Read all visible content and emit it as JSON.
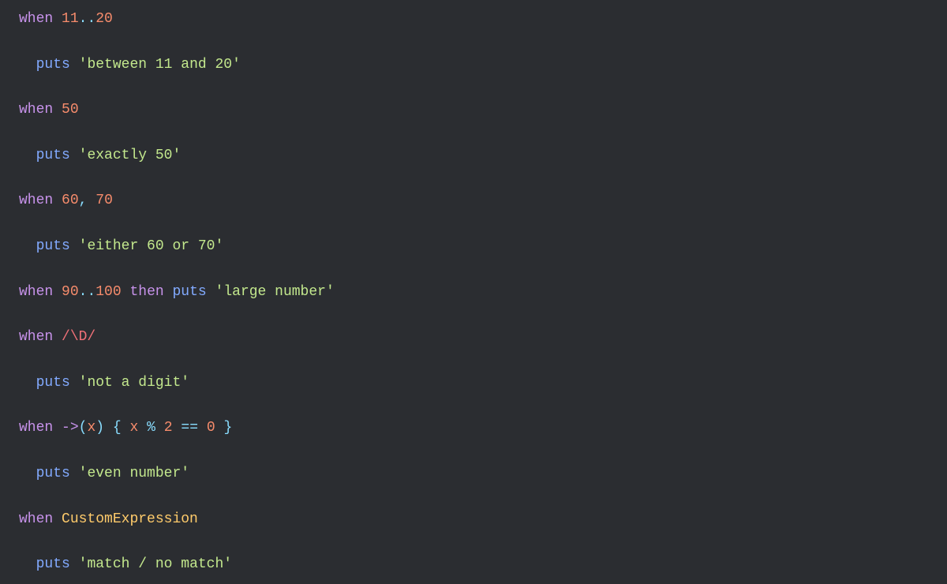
{
  "code": {
    "lines": [
      {
        "id": "line-when-11-20",
        "tokens": [
          {
            "type": "kw-when",
            "text": "when"
          },
          {
            "type": "plain",
            "text": " "
          },
          {
            "type": "num",
            "text": "11"
          },
          {
            "type": "op",
            "text": ".."
          },
          {
            "type": "num",
            "text": "20"
          }
        ]
      },
      {
        "id": "line-blank-1",
        "tokens": []
      },
      {
        "id": "line-puts-between",
        "tokens": [
          {
            "type": "plain",
            "text": "  "
          },
          {
            "type": "kw-puts",
            "text": "puts"
          },
          {
            "type": "plain",
            "text": " "
          },
          {
            "type": "str",
            "text": "'between 11 and 20'"
          }
        ]
      },
      {
        "id": "line-blank-2",
        "tokens": []
      },
      {
        "id": "line-when-50",
        "tokens": [
          {
            "type": "kw-when",
            "text": "when"
          },
          {
            "type": "plain",
            "text": " "
          },
          {
            "type": "num",
            "text": "50"
          }
        ]
      },
      {
        "id": "line-blank-3",
        "tokens": []
      },
      {
        "id": "line-puts-exactly",
        "tokens": [
          {
            "type": "plain",
            "text": "  "
          },
          {
            "type": "kw-puts",
            "text": "puts"
          },
          {
            "type": "plain",
            "text": " "
          },
          {
            "type": "str",
            "text": "'exactly 50'"
          }
        ]
      },
      {
        "id": "line-blank-4",
        "tokens": []
      },
      {
        "id": "line-when-60-70",
        "tokens": [
          {
            "type": "kw-when",
            "text": "when"
          },
          {
            "type": "plain",
            "text": " "
          },
          {
            "type": "num",
            "text": "60"
          },
          {
            "type": "punct",
            "text": ","
          },
          {
            "type": "plain",
            "text": " "
          },
          {
            "type": "num",
            "text": "70"
          }
        ]
      },
      {
        "id": "line-blank-5",
        "tokens": []
      },
      {
        "id": "line-puts-either",
        "tokens": [
          {
            "type": "plain",
            "text": "  "
          },
          {
            "type": "kw-puts",
            "text": "puts"
          },
          {
            "type": "plain",
            "text": " "
          },
          {
            "type": "str",
            "text": "'either 60 or 70'"
          }
        ]
      },
      {
        "id": "line-blank-6",
        "tokens": []
      },
      {
        "id": "line-when-90-100",
        "tokens": [
          {
            "type": "kw-when",
            "text": "when"
          },
          {
            "type": "plain",
            "text": " "
          },
          {
            "type": "num",
            "text": "90"
          },
          {
            "type": "op",
            "text": ".."
          },
          {
            "type": "num",
            "text": "100"
          },
          {
            "type": "plain",
            "text": " "
          },
          {
            "type": "kw-then",
            "text": "then"
          },
          {
            "type": "plain",
            "text": " "
          },
          {
            "type": "kw-puts",
            "text": "puts"
          },
          {
            "type": "plain",
            "text": " "
          },
          {
            "type": "str",
            "text": "'large number'"
          }
        ]
      },
      {
        "id": "line-blank-7",
        "tokens": []
      },
      {
        "id": "line-when-regex",
        "tokens": [
          {
            "type": "kw-when",
            "text": "when"
          },
          {
            "type": "plain",
            "text": " "
          },
          {
            "type": "regex",
            "text": "/\\D/"
          }
        ]
      },
      {
        "id": "line-blank-8",
        "tokens": []
      },
      {
        "id": "line-puts-digit",
        "tokens": [
          {
            "type": "plain",
            "text": "  "
          },
          {
            "type": "kw-puts",
            "text": "puts"
          },
          {
            "type": "plain",
            "text": " "
          },
          {
            "type": "str",
            "text": "'not a digit'"
          }
        ]
      },
      {
        "id": "line-blank-9",
        "tokens": []
      },
      {
        "id": "line-when-lambda",
        "tokens": [
          {
            "type": "kw-when",
            "text": "when"
          },
          {
            "type": "plain",
            "text": " "
          },
          {
            "type": "lambda",
            "text": "->"
          },
          {
            "type": "punct",
            "text": "("
          },
          {
            "type": "var",
            "text": "x"
          },
          {
            "type": "punct",
            "text": ")"
          },
          {
            "type": "plain",
            "text": " "
          },
          {
            "type": "punct",
            "text": "{"
          },
          {
            "type": "plain",
            "text": " "
          },
          {
            "type": "var",
            "text": "x"
          },
          {
            "type": "plain",
            "text": " "
          },
          {
            "type": "op",
            "text": "%"
          },
          {
            "type": "plain",
            "text": " "
          },
          {
            "type": "num",
            "text": "2"
          },
          {
            "type": "plain",
            "text": " "
          },
          {
            "type": "op",
            "text": "=="
          },
          {
            "type": "plain",
            "text": " "
          },
          {
            "type": "num",
            "text": "0"
          },
          {
            "type": "plain",
            "text": " "
          },
          {
            "type": "punct",
            "text": "}"
          }
        ]
      },
      {
        "id": "line-blank-10",
        "tokens": []
      },
      {
        "id": "line-puts-even",
        "tokens": [
          {
            "type": "plain",
            "text": "  "
          },
          {
            "type": "kw-puts",
            "text": "puts"
          },
          {
            "type": "plain",
            "text": " "
          },
          {
            "type": "str",
            "text": "'even number'"
          }
        ]
      },
      {
        "id": "line-blank-11",
        "tokens": []
      },
      {
        "id": "line-when-custom",
        "tokens": [
          {
            "type": "kw-when",
            "text": "when"
          },
          {
            "type": "plain",
            "text": " "
          },
          {
            "type": "const",
            "text": "CustomExpression"
          }
        ]
      },
      {
        "id": "line-blank-12",
        "tokens": []
      },
      {
        "id": "line-puts-match",
        "tokens": [
          {
            "type": "plain",
            "text": "  "
          },
          {
            "type": "kw-puts",
            "text": "puts"
          },
          {
            "type": "plain",
            "text": " "
          },
          {
            "type": "str",
            "text": "'match / no match'"
          }
        ]
      }
    ]
  }
}
